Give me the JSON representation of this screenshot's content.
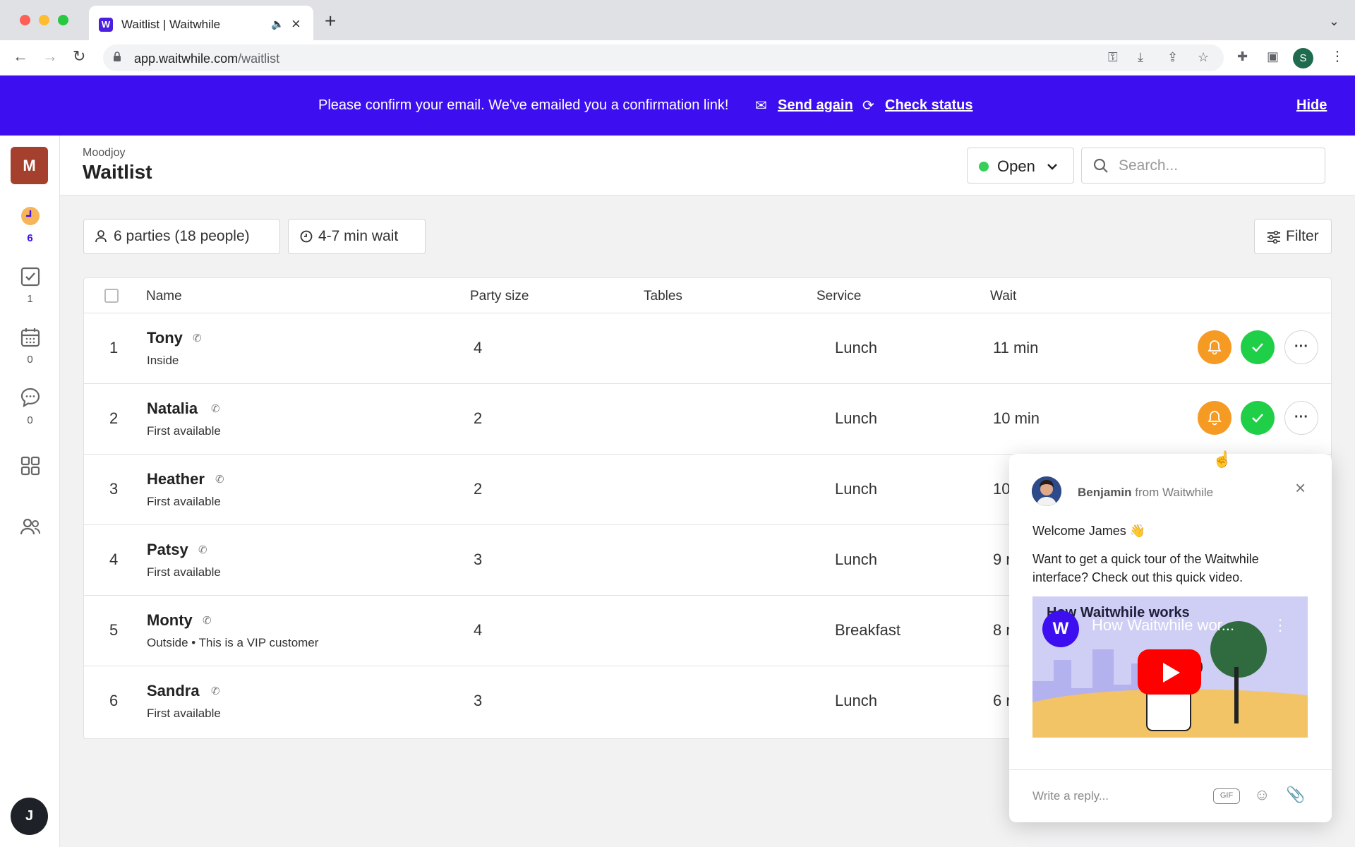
{
  "browser": {
    "tab_title": "Waitlist | Waitwhile",
    "favicon_letter": "W",
    "url_host": "app.waitwhile.com",
    "url_path": "/waitlist",
    "profile_initial": "S"
  },
  "banner": {
    "message": "Please confirm your email. We've emailed you a confirmation link!",
    "send_again": "Send again",
    "check_status": "Check status",
    "hide": "Hide",
    "color": "#3d0ff0"
  },
  "sidebar": {
    "org_initial": "M",
    "user_initial": "J",
    "items": [
      {
        "icon": "clock-icon",
        "count": "6"
      },
      {
        "icon": "checkbox-icon",
        "count": "1"
      },
      {
        "icon": "calendar-icon",
        "count": "0"
      },
      {
        "icon": "chat-icon",
        "count": "0"
      },
      {
        "icon": "grid-icon",
        "count": ""
      },
      {
        "icon": "users-icon",
        "count": ""
      }
    ]
  },
  "header": {
    "org": "Moodjoy",
    "title": "Waitlist",
    "status": "Open",
    "search_placeholder": "Search..."
  },
  "summary": {
    "parties": "6 parties (18 people)",
    "wait": "4-7 min wait",
    "filter": "Filter"
  },
  "table": {
    "columns": [
      "Name",
      "Party size",
      "Tables",
      "Service",
      "Wait"
    ],
    "rows": [
      {
        "num": "1",
        "name": "Tony",
        "sub": "Inside",
        "size": "4",
        "service": "Lunch",
        "wait": "11 min"
      },
      {
        "num": "2",
        "name": "Natalia",
        "sub": "First available",
        "size": "2",
        "service": "Lunch",
        "wait": "10 min"
      },
      {
        "num": "3",
        "name": "Heather",
        "sub": "First available",
        "size": "2",
        "service": "Lunch",
        "wait": "10"
      },
      {
        "num": "4",
        "name": "Patsy",
        "sub": "First available",
        "size": "3",
        "service": "Lunch",
        "wait": "9 r"
      },
      {
        "num": "5",
        "name": "Monty",
        "sub": "Outside  • This is a VIP customer",
        "size": "4",
        "service": "Breakfast",
        "wait": "8 r"
      },
      {
        "num": "6",
        "name": "Sandra",
        "sub": "First available",
        "size": "3",
        "service": "Lunch",
        "wait": "6 r"
      }
    ]
  },
  "chat": {
    "sender_name": "Benjamin",
    "sender_suffix": "from Waitwhile",
    "greeting": "Welcome James 👋",
    "body": "Want to get a quick tour of the Waitwhile interface? Check out this quick video.",
    "video_title": "How Waitwhile wor...",
    "video_bg_title": "How Waitwhile works",
    "video_logo": "W",
    "reply_placeholder": "Write a reply...",
    "gif_label": "GIF"
  }
}
